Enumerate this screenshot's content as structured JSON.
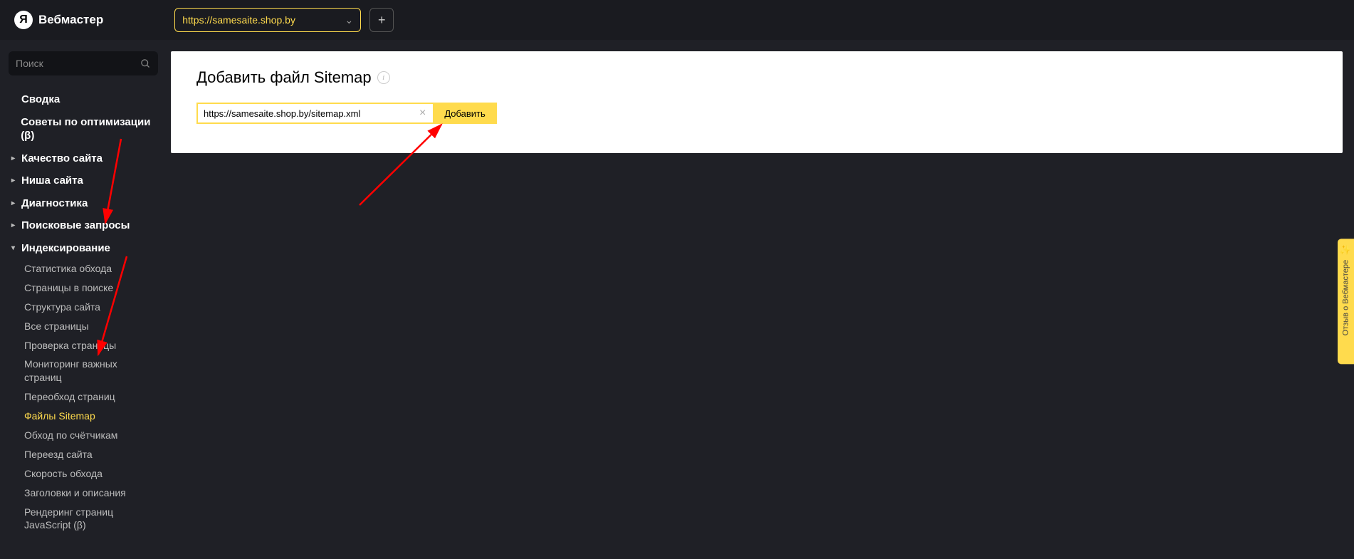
{
  "header": {
    "logo_letter": "Я",
    "product_name": "Вебмастер",
    "site_selector_value": "https://samesaite.shop.by",
    "add_site_symbol": "+"
  },
  "sidebar": {
    "search_placeholder": "Поиск",
    "items": [
      {
        "label": "Сводка",
        "caret": false
      },
      {
        "label": "Советы по оптимизации (β)",
        "caret": false
      },
      {
        "label": "Качество сайта",
        "caret": true
      },
      {
        "label": "Ниша сайта",
        "caret": true
      },
      {
        "label": "Диагностика",
        "caret": true
      },
      {
        "label": "Поисковые запросы",
        "caret": true
      },
      {
        "label": "Индексирование",
        "caret": true,
        "expanded": true
      }
    ],
    "indexing_children": [
      {
        "label": "Статистика обхода"
      },
      {
        "label": "Страницы в поиске"
      },
      {
        "label": "Структура сайта"
      },
      {
        "label": "Все страницы"
      },
      {
        "label": "Проверка страницы"
      },
      {
        "label": "Мониторинг важных страниц"
      },
      {
        "label": "Переобход страниц"
      },
      {
        "label": "Файлы Sitemap",
        "active": true
      },
      {
        "label": "Обход по счётчикам"
      },
      {
        "label": "Переезд сайта"
      },
      {
        "label": "Скорость обхода"
      },
      {
        "label": "Заголовки и описания"
      },
      {
        "label": "Рендеринг страниц JavaScript (β)"
      }
    ]
  },
  "panel": {
    "title": "Добавить файл Sitemap",
    "url_value": "https://samesaite.shop.by/sitemap.xml",
    "add_button": "Добавить"
  },
  "feedback": {
    "label": "Отзыв о Вебмастере"
  }
}
